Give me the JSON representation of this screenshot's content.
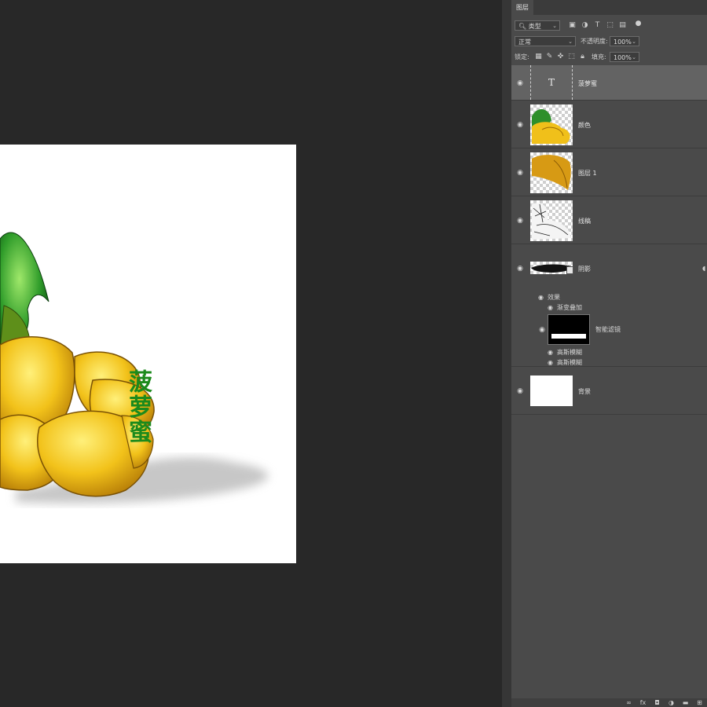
{
  "document": {
    "title_text": "菠萝蜜"
  },
  "panel": {
    "tab_label": "图层",
    "filter_kind": "类型",
    "blend_mode": "正常",
    "opacity_label": "不透明度:",
    "opacity_value": "100%",
    "lock_label": "锁定:",
    "fill_label": "填充:",
    "fill_value": "100%",
    "filter_icons": [
      "image-filter-icon",
      "adjustment-filter-icon",
      "type-filter-icon",
      "shape-filter-icon",
      "smart-object-filter-icon",
      "filter-toggle-icon"
    ],
    "lock_icons": [
      "lock-transparent-icon",
      "lock-image-icon",
      "lock-position-icon",
      "lock-artboard-icon",
      "lock-all-icon"
    ]
  },
  "layers": [
    {
      "name": "菠萝蜜",
      "type": "text",
      "selected": true
    },
    {
      "name": "颜色",
      "type": "pixel"
    },
    {
      "name": "图层 1",
      "type": "pixel"
    },
    {
      "name": "线稿",
      "type": "pixel"
    },
    {
      "name": "阴影",
      "type": "smart-object",
      "effects_label": "效果",
      "effects": [
        "渐变叠加"
      ],
      "smart_filter_label": "智能滤镜",
      "filters": [
        "高斯模糊",
        "高斯模糊"
      ]
    },
    {
      "name": "背景",
      "type": "background"
    }
  ],
  "footer_icons": [
    "link-layers-icon",
    "fx-icon",
    "add-mask-icon",
    "adjustment-layer-icon",
    "new-group-icon",
    "new-layer-icon"
  ],
  "colors": {
    "workspace": "#282828",
    "panel": "#4a4a4a",
    "selected_layer": "#636363",
    "title_green": "#1c8a1c",
    "fruit_yellow": "#f2c21a"
  }
}
